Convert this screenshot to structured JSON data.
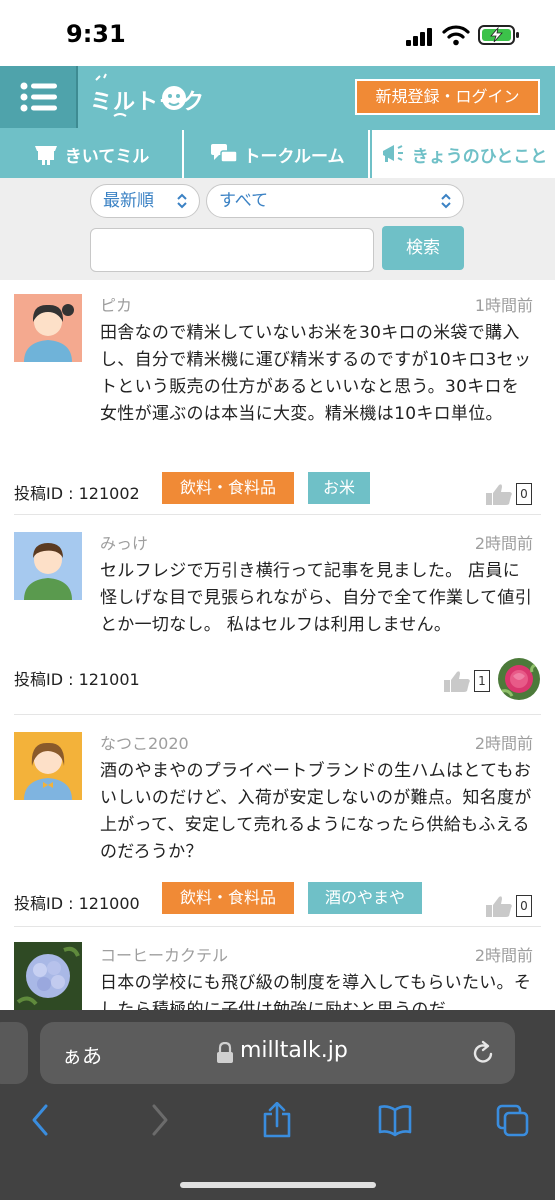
{
  "status_bar": {
    "time": "9:31"
  },
  "header": {
    "logo_text": "ミルトーク",
    "login_label": "新規登録・ログイン"
  },
  "tabs": [
    {
      "label": "きいてミル",
      "icon": "booth-icon"
    },
    {
      "label": "トークルーム",
      "icon": "chat-bubbles-icon"
    },
    {
      "label": "きょうのひとこと",
      "icon": "megaphone-icon",
      "active": true
    }
  ],
  "filters": {
    "sort_value": "最新順",
    "category_value": "すべて",
    "search_placeholder": "",
    "search_label": "検索"
  },
  "posts": [
    {
      "username": "ピカ",
      "time": "1時間前",
      "body": "田舎なので精米していないお米を30キロの米袋で購入し、自分で精米機に運び精米するのですが10キロ3セットという販売の仕方があるといいなと思う。30キロを女性が運ぶのは本当に大変。精米機は10キロ単位。",
      "post_id": "投稿ID : 121002",
      "tags": [
        "飲料・食料品",
        "お米"
      ],
      "likes": "0"
    },
    {
      "username": "みっけ",
      "time": "2時間前",
      "body": "セルフレジで万引き横行って記事を見ました。 店員に怪しげな目で見張られながら、自分で全て作業して値引とか一切なし。 私はセルフは利用しません。",
      "post_id": "投稿ID : 121001",
      "tags": [],
      "likes": "1"
    },
    {
      "username": "なつこ2020",
      "time": "2時間前",
      "body": "酒のやまやのプライベートブランドの生ハムはとてもおいしいのだけど、入荷が安定しないのが難点。知名度が上がって、安定して売れるようになったら供給もふえるのだろうか？",
      "post_id": "投稿ID : 121000",
      "tags": [
        "飲料・食料品",
        "酒のやまや"
      ],
      "likes": "0"
    },
    {
      "username": "コーヒーカクテル",
      "time": "2時間前",
      "body": "日本の学校にも飛び級の制度を導入してもらいたい。そしたら積極的に子供は勉強に励むと思うのだ"
    }
  ],
  "browser": {
    "aa_label": "ぁあ",
    "url": "milltalk.jp"
  },
  "colors": {
    "teal": "#6fc0c7",
    "orange": "#f08a36",
    "link_blue": "#3b82c4"
  }
}
